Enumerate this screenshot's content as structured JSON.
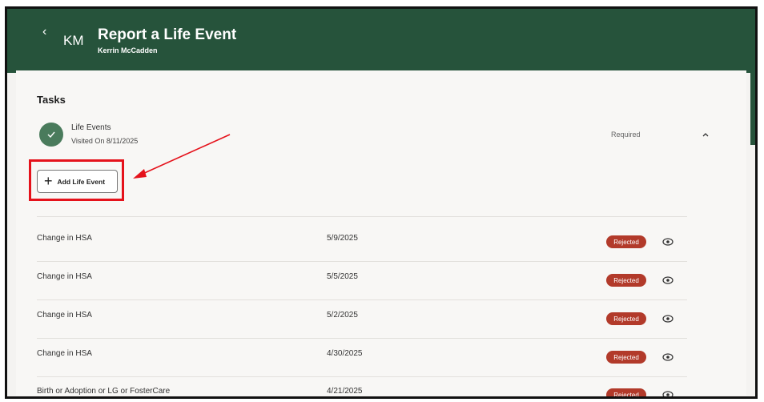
{
  "header": {
    "back_glyph": "‹",
    "initials": "KM",
    "title": "Report a Life Event",
    "subtitle": "Kerrin McCadden"
  },
  "tasks": {
    "heading": "Tasks",
    "task": {
      "name": "Life Events",
      "visited": "Visited On 8/11/2025",
      "status": "Required"
    },
    "add_button_label": "Add Life Event"
  },
  "events": [
    {
      "name": "Change in HSA",
      "date": "5/9/2025",
      "status": "Rejected"
    },
    {
      "name": "Change in HSA",
      "date": "5/5/2025",
      "status": "Rejected"
    },
    {
      "name": "Change in HSA",
      "date": "5/2/2025",
      "status": "Rejected"
    },
    {
      "name": "Change in HSA",
      "date": "4/30/2025",
      "status": "Rejected"
    },
    {
      "name": "Birth or Adoption or LG or FosterCare",
      "date": "4/21/2025",
      "status": "Rejected"
    }
  ],
  "colors": {
    "header_bg": "#26533b",
    "rejected_badge": "#b23a2a",
    "highlight": "#e5121b"
  }
}
